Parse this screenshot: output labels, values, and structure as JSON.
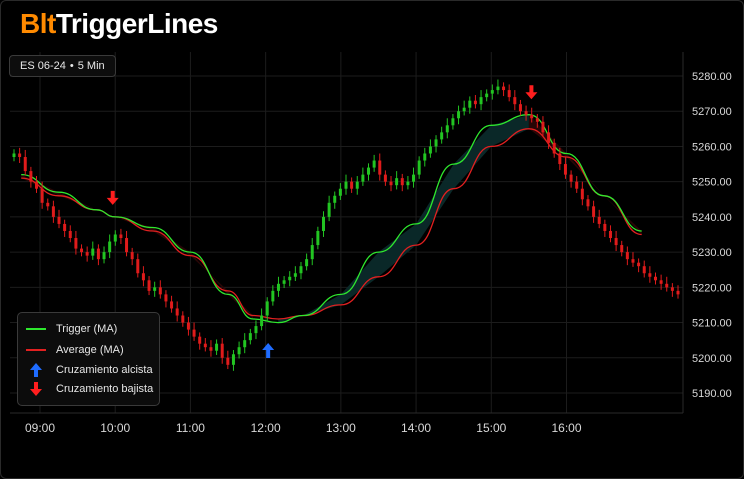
{
  "header": {
    "brand_prefix": "Blt",
    "brand_suffix": "TriggerLines",
    "symbol": "ES 06-24",
    "separator": "•",
    "timeframe": "5 Min"
  },
  "colors": {
    "up_candle": "#22c522",
    "down_candle": "#e01b1b",
    "trigger_line": "#2ee82e",
    "average_line": "#e22020",
    "bull_fill": "#0b2a2a",
    "bear_fill": "#2a0606",
    "bull_arrow": "#1f6cff",
    "bear_arrow": "#ff1e1e",
    "brand_accent": "#ff8a00"
  },
  "legend": {
    "trigger": "Trigger (MA)",
    "average": "Average (MA)",
    "bull_cross": "Cruzamiento alcista",
    "bear_cross": "Cruzamiento bajista"
  },
  "chart_data": {
    "type": "candlestick",
    "y_axis_position": "right",
    "ylim": [
      5185,
      5284
    ],
    "y_ticks": [
      "5190.00",
      "5200.00",
      "5210.00",
      "5220.00",
      "5230.00",
      "5240.00",
      "5250.00",
      "5260.00",
      "5270.00",
      "5280.00"
    ],
    "x_ticks": [
      "09:00",
      "10:00",
      "11:00",
      "12:00",
      "13:00",
      "14:00",
      "15:00",
      "16:00"
    ],
    "grid": true,
    "legend_position": "bottom-left",
    "series": [
      {
        "name": "Trigger (MA)",
        "x": [
          "08:45",
          "09:15",
          "09:45",
          "10:00",
          "10:30",
          "11:00",
          "11:30",
          "11:50",
          "12:10",
          "12:30",
          "13:00",
          "13:30",
          "14:00",
          "14:30",
          "15:00",
          "15:30",
          "16:00",
          "16:30",
          "17:00"
        ],
        "values": [
          5252,
          5247,
          5242,
          5240,
          5237,
          5230,
          5218,
          5211,
          5210,
          5212,
          5218,
          5230,
          5238,
          5255,
          5266,
          5269,
          5258,
          5246,
          5236
        ]
      },
      {
        "name": "Average (MA)",
        "x": [
          "08:45",
          "09:15",
          "09:45",
          "10:00",
          "10:30",
          "11:00",
          "11:30",
          "11:50",
          "12:10",
          "12:30",
          "13:00",
          "13:30",
          "14:00",
          "14:30",
          "15:00",
          "15:30",
          "16:00",
          "16:30",
          "17:00"
        ],
        "values": [
          5251,
          5246,
          5242,
          5240,
          5236,
          5229,
          5219,
          5212,
          5211,
          5212,
          5215,
          5223,
          5232,
          5248,
          5260,
          5265,
          5257,
          5246,
          5235
        ]
      }
    ],
    "candles_close": [
      5258,
      5257,
      5253,
      5250,
      5248,
      5244,
      5243,
      5240,
      5238,
      5236,
      5234,
      5231,
      5230,
      5229,
      5231,
      5228,
      5230,
      5233,
      5235,
      5234,
      5230,
      5228,
      5224,
      5222,
      5219,
      5220,
      5218,
      5216,
      5214,
      5212,
      5210,
      5208,
      5206,
      5204,
      5203,
      5202,
      5204,
      5200,
      5198,
      5201,
      5203,
      5205,
      5207,
      5209,
      5212,
      5216,
      5219,
      5221,
      5222,
      5223,
      5224,
      5226,
      5228,
      5232,
      5236,
      5240,
      5244,
      5246,
      5248,
      5250,
      5248,
      5250,
      5252,
      5254,
      5256,
      5252,
      5250,
      5249,
      5251,
      5249,
      5250,
      5252,
      5256,
      5258,
      5260,
      5262,
      5264,
      5266,
      5268,
      5270,
      5271,
      5273,
      5272,
      5274,
      5275,
      5276,
      5277,
      5276,
      5274,
      5272,
      5270,
      5269,
      5268,
      5267,
      5264,
      5261,
      5258,
      5255,
      5252,
      5250,
      5248,
      5245,
      5243,
      5240,
      5238,
      5236,
      5234,
      5232,
      5230,
      5228,
      5227,
      5226,
      5224,
      5223,
      5222,
      5221,
      5220,
      5219,
      5218
    ],
    "crossovers": [
      {
        "type": "bajista",
        "time": "09:58",
        "price": 5240
      },
      {
        "type": "alcista",
        "time": "12:02",
        "price": 5211
      },
      {
        "type": "bajista",
        "time": "15:32",
        "price": 5270
      }
    ]
  }
}
